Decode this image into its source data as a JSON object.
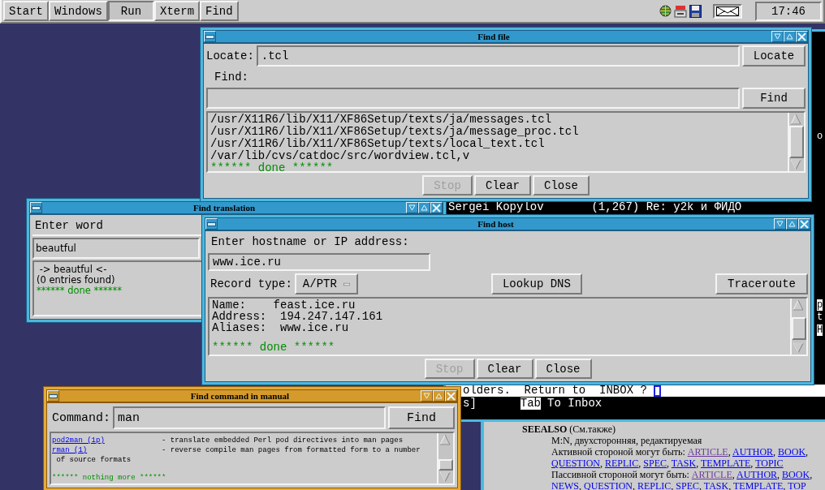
{
  "taskbar": {
    "buttons": [
      {
        "label": "Start",
        "selected": false
      },
      {
        "label": "Windows",
        "selected": false
      },
      {
        "label": "Run",
        "selected": true
      },
      {
        "label": "Xterm",
        "selected": false
      },
      {
        "label": "Find",
        "selected": false
      }
    ],
    "clock": "17:46"
  },
  "terminal": {
    "message_line": "Sergei Kopylov       (1,267) Re: y2k и ФИДО",
    "prompt": "olders.  Return to  INBOX ? ",
    "keys_prefix": "s]",
    "keys": [
      {
        "key": "Tab",
        "label": "To Inbox"
      }
    ],
    "edge_fragments": [
      "o",
      "p",
      "t",
      "H"
    ]
  },
  "browser": {
    "lines": [
      {
        "text": "**SEEALSO** (См.также)"
      },
      {
        "text": "M:N, двухсторонняя, редактируемая"
      },
      {
        "text": "Активной стороной могут быть: ",
        "links": [
          {
            "text": "ARTICLE",
            "visited": true,
            "sep": ", "
          },
          {
            "text": "AUTHOR",
            "visited": false,
            "sep": ", "
          },
          {
            "text": "BOOK",
            "visited": false,
            "sep": ","
          }
        ]
      },
      {
        "links": [
          {
            "text": "QUESTION",
            "visited": false,
            "sep": ", "
          },
          {
            "text": "REPLIC",
            "visited": false,
            "sep": ", "
          },
          {
            "text": "SPEC",
            "visited": false,
            "sep": ", "
          },
          {
            "text": "TASK",
            "visited": false,
            "sep": ", "
          },
          {
            "text": "TEMPLATE",
            "visited": false,
            "sep": ", "
          },
          {
            "text": "TOPIC",
            "visited": false
          }
        ]
      },
      {
        "text": "Пассивной стороной могут быть: ",
        "links": [
          {
            "text": "ARTICLE",
            "visited": true,
            "sep": ", "
          },
          {
            "text": "AUTHOR",
            "visited": false,
            "sep": ", "
          },
          {
            "text": "BOOK",
            "visited": false,
            "sep": ","
          }
        ]
      },
      {
        "links": [
          {
            "text": "NEWS",
            "visited": false,
            "sep": ", "
          },
          {
            "text": "QUESTION",
            "visited": false,
            "sep": ", "
          },
          {
            "text": "REPLIC",
            "visited": false,
            "sep": ", "
          },
          {
            "text": "SPEC",
            "visited": false,
            "sep": ", "
          },
          {
            "text": "TASK",
            "visited": false,
            "sep": ", "
          },
          {
            "text": "TEMPLATE",
            "visited": false,
            "sep": ", "
          },
          {
            "text": "TOP",
            "visited": false
          }
        ]
      }
    ]
  },
  "find_translation": {
    "title": "Find translation",
    "label": "Enter word",
    "value": "beautful",
    "results": [
      " -> beautful <-",
      "(0 entries found)"
    ],
    "status": "****** done ******"
  },
  "find_file": {
    "title": "Find file",
    "locate_label": "Locate:",
    "locate_value": ".tcl",
    "locate_button": "Locate",
    "find_label": "Find:",
    "find_button": "Find",
    "results": [
      "/usr/X11R6/lib/X11/XF86Setup/texts/ja/messages.tcl",
      "/usr/X11R6/lib/X11/XF86Setup/texts/ja/message_proc.tcl",
      "/usr/X11R6/lib/X11/XF86Setup/texts/local_text.tcl",
      "/var/lib/cvs/catdoc/src/wordview.tcl,v"
    ],
    "status": "****** done ******",
    "buttons": [
      {
        "label": "Stop",
        "disabled": true
      },
      {
        "label": "Clear",
        "disabled": false
      },
      {
        "label": "Close",
        "disabled": false
      }
    ]
  },
  "find_host": {
    "title": "Find host",
    "label": "Enter hostname or IP address:",
    "value": "www.ice.ru",
    "record_label": "Record type:",
    "record_value": "A/PTR",
    "lookup_button": "Lookup DNS",
    "traceroute_button": "Traceroute",
    "results": [
      "Name:    feast.ice.ru",
      "Address:  194.247.147.161",
      "Aliases:  www.ice.ru"
    ],
    "status": "****** done ******",
    "buttons": [
      {
        "label": "Stop",
        "disabled": true
      },
      {
        "label": "Clear",
        "disabled": false
      },
      {
        "label": "Close",
        "disabled": false
      }
    ]
  },
  "find_command": {
    "title": "Find command in manual",
    "label": "Command:",
    "value": "man",
    "button": "Find",
    "results": [
      {
        "command": "pod2man (1p)",
        "description": "- translate embedded Perl pod directives into man pages"
      },
      {
        "command": "rman (1)",
        "description": "- reverse compile man pages from formatted form to a number",
        "continuation": " of source formats"
      }
    ],
    "status": "****** nothing more ******"
  }
}
